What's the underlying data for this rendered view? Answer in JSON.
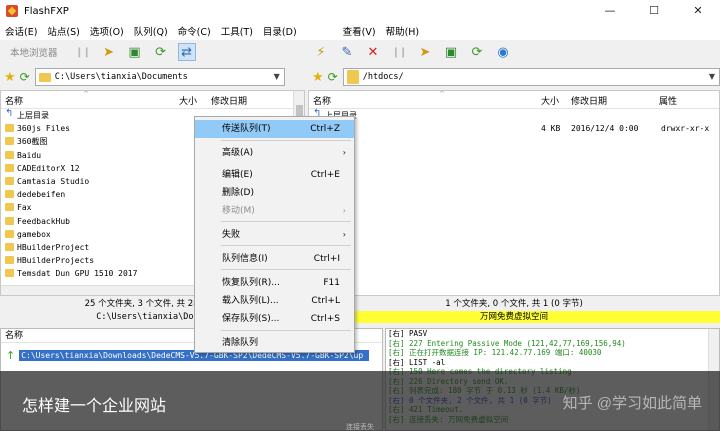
{
  "window": {
    "title": "FlashFXP",
    "minimize": "—",
    "maximize": "☐",
    "close": "✕"
  },
  "menubar": {
    "left": [
      "会话(E)",
      "站点(S)",
      "选项(O)",
      "队列(Q)",
      "命令(C)",
      "工具(T)",
      "目录(D)"
    ],
    "right": [
      "查看(V)",
      "帮助(H)"
    ]
  },
  "toolbar_left": {
    "label": "本地浏览器"
  },
  "path_left": {
    "value": "C:\\Users\\tianxia\\Documents"
  },
  "path_right": {
    "value": "/htdocs/"
  },
  "left_pane": {
    "headers": {
      "name": "名称",
      "size": "大小",
      "date": "修改日期"
    },
    "rows": [
      "上层目录",
      "360js Files",
      "360截图",
      "Baidu",
      "CADEditorX 12",
      "Camtasia Studio",
      "dedebeifen",
      "Fax",
      "FeedbackHub",
      "gamebox",
      "HBuilderProject",
      "HBuilderProjects",
      "Temsdat Dun GPU 1510 2017"
    ]
  },
  "right_pane": {
    "headers": {
      "name": "名称",
      "size": "大小",
      "date": "修改日期",
      "attr": "属性"
    },
    "rows": [
      {
        "name": "上层目录",
        "size": "",
        "date": "",
        "attr": ""
      },
      {
        "name": "ort",
        "size": "4 KB",
        "date": "2016/12/4 0:00",
        "attr": "drwxr-xr-x"
      }
    ]
  },
  "status": {
    "left_1": "25 个文件夹, 3 个文件, 共 28 30 K",
    "left_2": "C:\\Users\\tianxia\\Docum",
    "right_1": "1 个文件夹, 0 个文件, 共 1 (0 字节)",
    "right_2": "万网免费虚拟空间"
  },
  "queue": {
    "header": "名称",
    "path": "C:\\Users\\tianxia\\Downloads\\DedeCMS-V5.7-GBK-SP2\\DedeCMS-V5.7-GBK-SP2\\up"
  },
  "log": [
    {
      "text": "[右] PASV",
      "color": "black"
    },
    {
      "text": "[右] 227 Entering Passive Mode (121,42,77,169,156,94)",
      "color": "green"
    },
    {
      "text": "[右] 正在打开数据连接 IP: 121.42.77.169 端口: 40030",
      "color": "green"
    },
    {
      "text": "[右] LIST -al",
      "color": "black"
    },
    {
      "text": "[右] 150 Here comes the directory listing",
      "color": "green"
    },
    {
      "text": "[右] 226 Directory send OK.",
      "color": "green"
    },
    {
      "text": "[右] 列表完成: 180 字节 于 0.13 秒 (1.4 KB/秒)",
      "color": "green"
    },
    {
      "text": "[右] 0 个文件夹, 2 个文件, 共 1 (0 字节)",
      "color": "blue"
    },
    {
      "text": "[右] 421 Timeout.",
      "color": "green"
    },
    {
      "text": "[右] 连接丢失: 万网免费虚拟空间",
      "color": "green"
    }
  ],
  "context_menu": [
    {
      "label": "传送队列(T)",
      "shortcut": "Ctrl+Z",
      "state": "highlight"
    },
    {
      "label": "高级(A)",
      "shortcut": "",
      "submenu": true
    },
    {
      "label": "编辑(E)",
      "shortcut": "Ctrl+E"
    },
    {
      "label": "删除(D)",
      "shortcut": ""
    },
    {
      "label": "移动(M)",
      "shortcut": "",
      "submenu": true,
      "state": "disabled"
    },
    {
      "label": "失败",
      "shortcut": "",
      "submenu": true
    },
    {
      "label": "队列信息(I)",
      "shortcut": "Ctrl+I"
    },
    {
      "label": "恢复队列(R)...",
      "shortcut": "F11"
    },
    {
      "label": "载入队列(L)...",
      "shortcut": "Ctrl+L"
    },
    {
      "label": "保存队列(S)...",
      "shortcut": "Ctrl+S"
    },
    {
      "label": "清除队列",
      "shortcut": ""
    }
  ],
  "overlay": {
    "title": "怎样建一个企业网站",
    "watermark": "知乎 @学习如此简单",
    "bottom_text": "连接丢失"
  },
  "colors": {
    "highlight": "#91c9f7",
    "selected": "#3470c8",
    "status_yellow": "#ffff33",
    "log_green": "#1e8a1e"
  }
}
